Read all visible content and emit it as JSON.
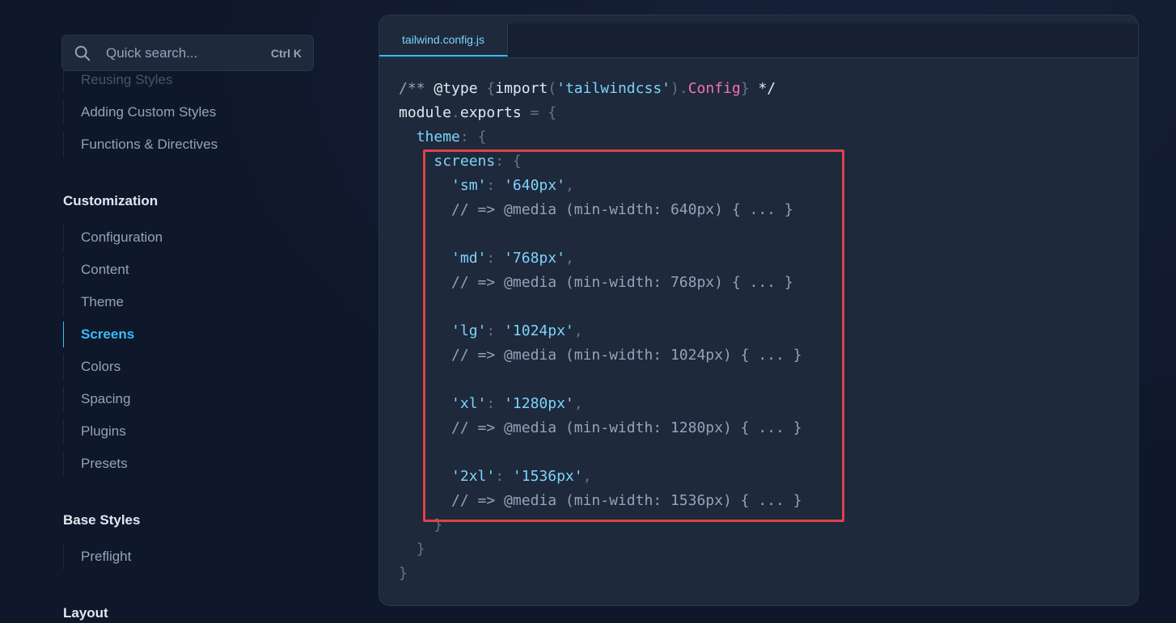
{
  "search": {
    "placeholder": "Quick search...",
    "shortcut": "Ctrl K",
    "icon": "search-icon"
  },
  "sidebar": {
    "top_items": [
      {
        "label": "Reusing Styles"
      },
      {
        "label": "Adding Custom Styles"
      },
      {
        "label": "Functions & Directives"
      }
    ],
    "sections": [
      {
        "heading": "Customization",
        "items": [
          {
            "label": "Configuration"
          },
          {
            "label": "Content"
          },
          {
            "label": "Theme"
          },
          {
            "label": "Screens",
            "active": true
          },
          {
            "label": "Colors"
          },
          {
            "label": "Spacing"
          },
          {
            "label": "Plugins"
          },
          {
            "label": "Presets"
          }
        ]
      },
      {
        "heading": "Base Styles",
        "items": [
          {
            "label": "Preflight"
          }
        ]
      },
      {
        "heading": "Layout",
        "items": []
      }
    ]
  },
  "editor": {
    "tab": "tailwind.config.js",
    "lines": [
      "/** @type {import('tailwindcss').Config} */",
      "module.exports = {",
      "  theme: {",
      "    screens: {",
      "      'sm': '640px',",
      "      // => @media (min-width: 640px) { ... }",
      "",
      "      'md': '768px',",
      "      // => @media (min-width: 768px) { ... }",
      "",
      "      'lg': '1024px',",
      "      // => @media (min-width: 1024px) { ... }",
      "",
      "      'xl': '1280px',",
      "      // => @media (min-width: 1280px) { ... }",
      "",
      "      '2xl': '1536px',",
      "      // => @media (min-width: 1536px) { ... }",
      "    }",
      "  }",
      "}"
    ]
  },
  "colors": {
    "accent": "#38bdf8",
    "highlight_box": "#e0414a",
    "background": "#0f172a"
  }
}
